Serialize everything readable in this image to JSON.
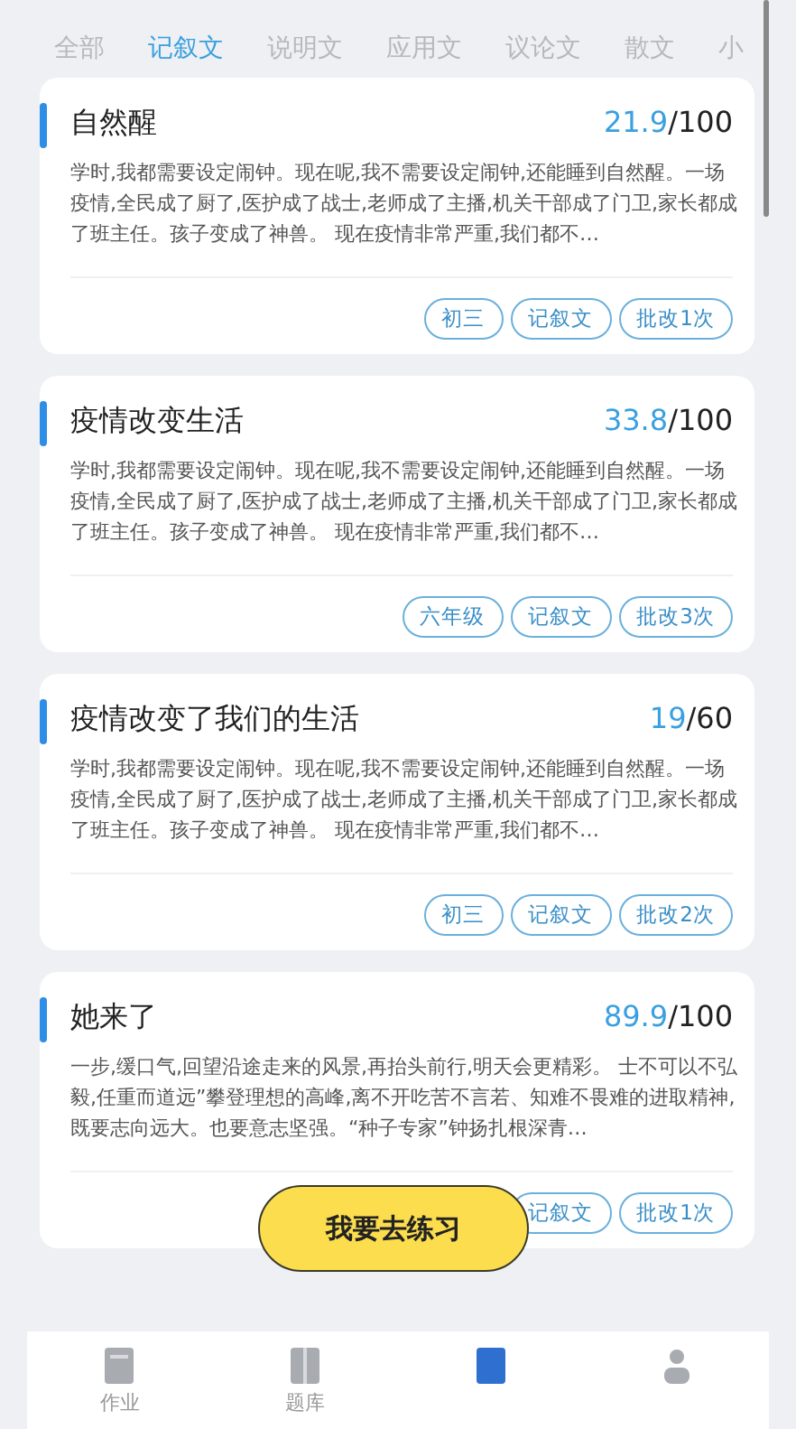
{
  "tabs": [
    {
      "label": "全部",
      "selected": false
    },
    {
      "label": "记叙文",
      "selected": true
    },
    {
      "label": "说明文",
      "selected": false
    },
    {
      "label": "应用文",
      "selected": false
    },
    {
      "label": "议论文",
      "selected": false
    },
    {
      "label": "散文",
      "selected": false
    },
    {
      "label": "小",
      "selected": false
    }
  ],
  "essays": [
    {
      "title": "自然醒",
      "score": "21.9",
      "total": "/100",
      "excerpt": "学时,我都需要设定闹钟。现在呢,我不需要设定闹钟,还能睡到自然醒。一场疫情,全民成了厨了,医护成了战士,老师成了主播,机关干部成了门卫,家长都成了班主任。孩子变成了神兽。 现在疫情非常严重,我们都不…",
      "tags": [
        "初三",
        "记叙文",
        "批改1次"
      ]
    },
    {
      "title": "疫情改变生活",
      "score": "33.8",
      "total": "/100",
      "excerpt": "学时,我都需要设定闹钟。现在呢,我不需要设定闹钟,还能睡到自然醒。一场疫情,全民成了厨了,医护成了战士,老师成了主播,机关干部成了门卫,家长都成了班主任。孩子变成了神兽。 现在疫情非常严重,我们都不…",
      "tags": [
        "六年级",
        "记叙文",
        "批改3次"
      ]
    },
    {
      "title": "疫情改变了我们的生活",
      "score": "19",
      "total": "/60",
      "excerpt": "学时,我都需要设定闹钟。现在呢,我不需要设定闹钟,还能睡到自然醒。一场疫情,全民成了厨了,医护成了战士,老师成了主播,机关干部成了门卫,家长都成了班主任。孩子变成了神兽。 现在疫情非常严重,我们都不…",
      "tags": [
        "初三",
        "记叙文",
        "批改2次"
      ]
    },
    {
      "title": "她来了",
      "score": "89.9",
      "total": "/100",
      "excerpt": "一步,缓口气,回望沿途走来的风景,再抬头前行,明天会更精彩。 士不可以不弘毅,任重而道远”攀登理想的高峰,离不开吃苦不言若、知难不畏难的进取精神,既要志向远大。也要意志坚强。“种子专家”钟扬扎根深青…",
      "tags": [
        "记叙文",
        "批改1次"
      ]
    }
  ],
  "practice_button": "我要去练习",
  "bottom_nav": [
    {
      "label": "作业"
    },
    {
      "label": "题库"
    }
  ]
}
